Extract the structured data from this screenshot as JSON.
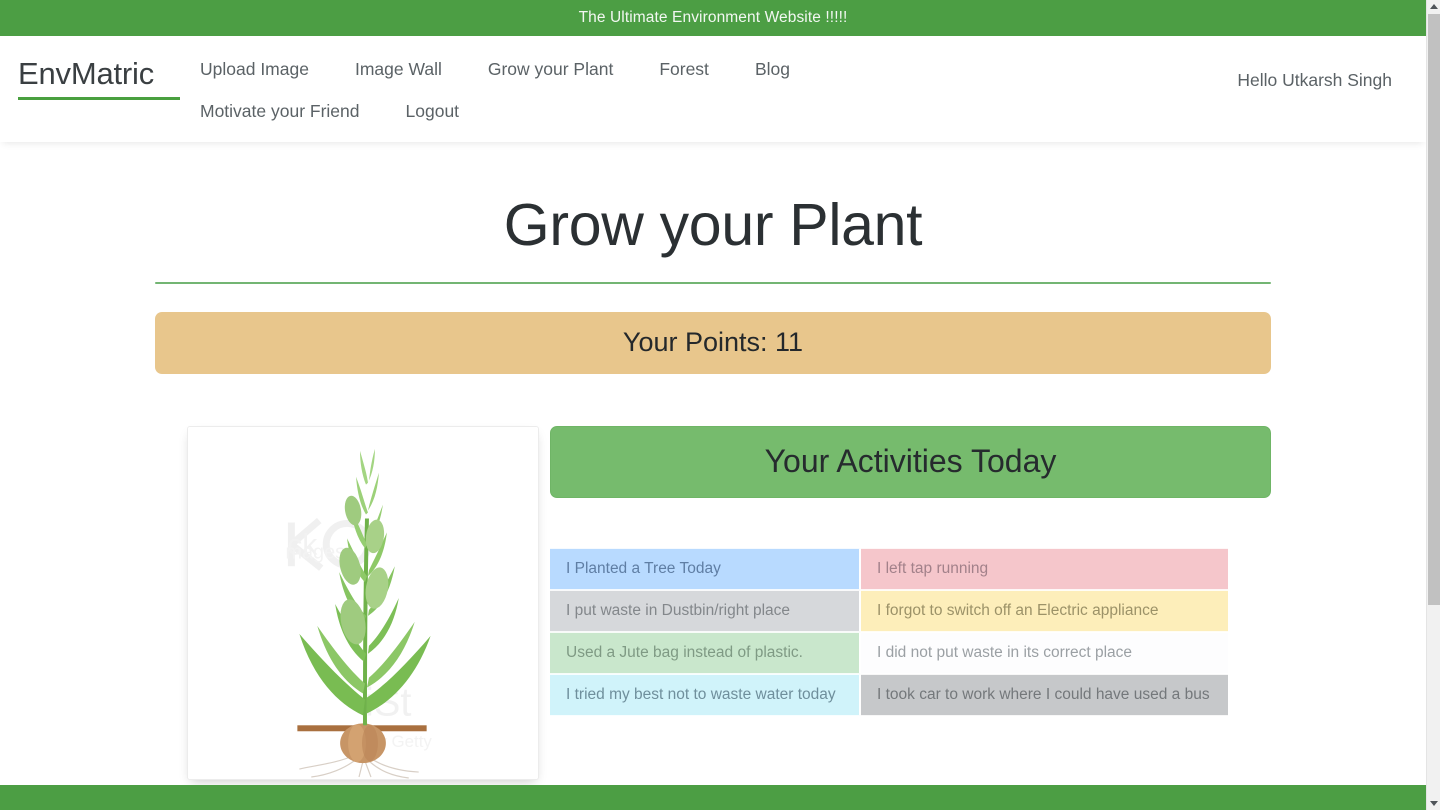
{
  "announcement": {
    "text": "The Ultimate Environment Website !!!!!",
    "background_color": "#4c9e44",
    "text_color": "#f2f7f1"
  },
  "navbar": {
    "brand": "EnvMatric",
    "brand_underline_color": "#49a03f",
    "links": [
      {
        "label": "Upload Image"
      },
      {
        "label": "Image Wall"
      },
      {
        "label": "Grow your Plant"
      },
      {
        "label": "Forest"
      },
      {
        "label": "Blog"
      },
      {
        "label": "Motivate your Friend"
      },
      {
        "label": "Logout"
      }
    ],
    "user_greeting": "Hello Utkarsh Singh"
  },
  "main": {
    "page_title": "Grow your Plant",
    "rule_color": "#5aa85a",
    "points_banner": {
      "text": "Your Points: 11",
      "points_value": 11,
      "background_color": "#e8c68c"
    },
    "plant_image": {
      "alt": "Growing plant illustration with bulb and roots",
      "watermark": "iStock"
    },
    "activities": {
      "header": "Your Activities Today",
      "header_background_color": "#76bb6d",
      "rows": [
        {
          "positive": "I Planted a Tree Today",
          "positive_color": "#b8daff",
          "negative": "I left tap running",
          "negative_color": "#f5c6cb"
        },
        {
          "positive": "I put waste in Dustbin/right place",
          "positive_color": "#d6d8db",
          "negative": "I forgot to switch off an Electric appliance",
          "negative_color": "#fdeeba"
        },
        {
          "positive": "Used a Jute bag instead of plastic.",
          "positive_color": "#c9e7cc",
          "negative": "I did not put waste in its correct place",
          "negative_color": "#fdfdfe"
        },
        {
          "positive": "I tried my best not to waste water today",
          "positive_color": "#d0f3fa",
          "negative": "I took car to work where I could have used a bus",
          "negative_color": "#c6c8ca"
        }
      ]
    }
  },
  "footer": {
    "background_color": "#4c9e44"
  }
}
